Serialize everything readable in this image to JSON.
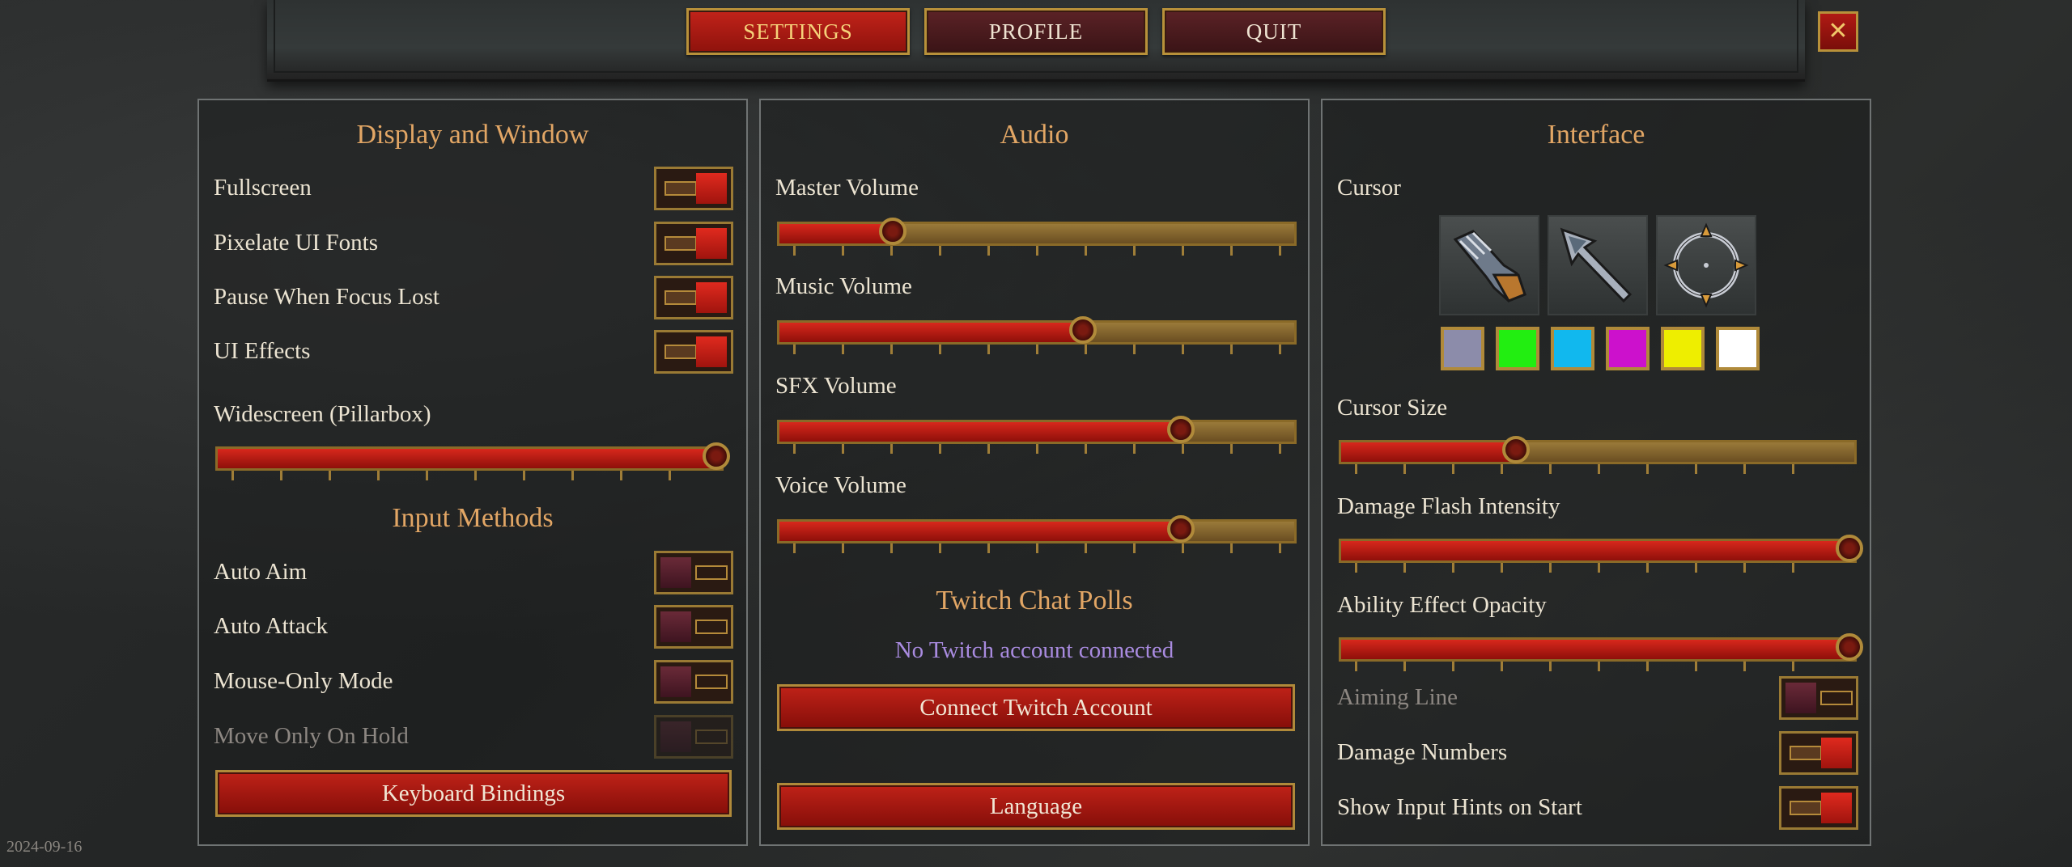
{
  "tabs": {
    "settings": "SETTINGS",
    "profile": "PROFILE",
    "quit": "QUIT"
  },
  "close_icon": "close-x-icon",
  "display": {
    "title": "Display and Window",
    "fullscreen": "Fullscreen",
    "pixelate": "Pixelate UI Fonts",
    "pause": "Pause When Focus Lost",
    "uieffects": "UI Effects",
    "widescreen": "Widescreen (Pillarbox)",
    "widescreen_value": 1.0,
    "toggles": {
      "fullscreen": true,
      "pixelate": true,
      "pause": true,
      "uieffects": true
    }
  },
  "input": {
    "title": "Input Methods",
    "autoaim": "Auto Aim",
    "autoattack": "Auto Attack",
    "mouseonly": "Mouse-Only Mode",
    "moveonhold": "Move Only On Hold",
    "toggles": {
      "autoaim": false,
      "autoattack": false,
      "mouseonly": false,
      "moveonhold": false
    },
    "keyboard_bindings": "Keyboard Bindings"
  },
  "audio": {
    "title": "Audio",
    "master": "Master Volume",
    "music": "Music Volume",
    "sfx": "SFX Volume",
    "voice": "Voice Volume",
    "levels": {
      "master": 0.22,
      "music": 0.59,
      "sfx": 0.78,
      "voice": 0.78
    }
  },
  "twitch": {
    "title": "Twitch Chat Polls",
    "status": "No Twitch account connected",
    "connect": "Connect Twitch Account"
  },
  "language": "Language",
  "interface": {
    "title": "Interface",
    "cursor": "Cursor",
    "cursor_options": [
      "gauntlet-cursor-icon",
      "arrow-cursor-icon",
      "crosshair-cursor-icon"
    ],
    "cursor_colors": [
      "#8c8caa",
      "#22ee11",
      "#11b8ee",
      "#cc11cc",
      "#eeee00",
      "#ffffff"
    ],
    "cursor_size": "Cursor Size",
    "damage_flash": "Damage Flash Intensity",
    "ability_opacity": "Ability Effect Opacity",
    "aiming_line": "Aiming Line",
    "damage_numbers": "Damage Numbers",
    "input_hints": "Show Input Hints on Start",
    "levels": {
      "cursor_size": 0.34,
      "damage_flash": 1.0,
      "ability_opacity": 1.0
    },
    "toggles": {
      "aiming_line": false,
      "damage_numbers": true,
      "input_hints": true
    }
  },
  "date": "2024-09-16"
}
